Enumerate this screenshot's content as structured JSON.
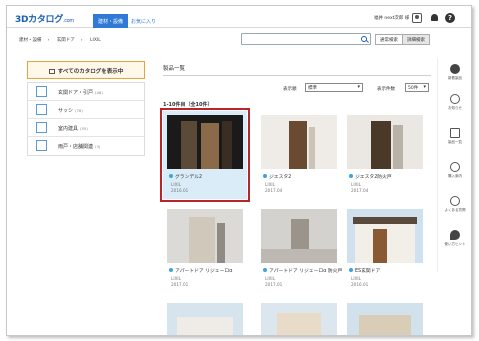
{
  "brand": {
    "name": "3Dカタログ",
    "suffix": ".com"
  },
  "nav": {
    "active_tab": "建材・設備",
    "favorites_tab": "お気に入り"
  },
  "user": {
    "label": "福井 next次郎 様"
  },
  "breadcrumb": [
    "建材・設備",
    "玄関ドア",
    "LIXIL"
  ],
  "search": {
    "value": "",
    "placeholder": ""
  },
  "modes": {
    "simple": "通常検索",
    "detail": "詳細検索"
  },
  "sidebar": {
    "show_all": "すべてのカタログを表示中",
    "items": [
      {
        "label": "玄関ドア・引戸",
        "count": "(48)",
        "icon": "door-icon"
      },
      {
        "label": "サッシ",
        "count": "(78)",
        "icon": "window-icon"
      },
      {
        "label": "室内建具",
        "count": "(55)",
        "icon": "interior-door-icon"
      },
      {
        "label": "雨戸・店舗関連",
        "count": "(3)",
        "icon": "storefront-icon"
      }
    ]
  },
  "main": {
    "section_title": "製品一覧",
    "sort_label": "表示順",
    "sort_value": "標準",
    "count_label": "表示件数",
    "count_value": "50件",
    "range_text": "1-10件目（全10件）"
  },
  "products": [
    {
      "title": "グランデル2",
      "maker": "LIXIL",
      "date": "2016.01",
      "selected": true
    },
    {
      "title": "ジエスタ2",
      "maker": "LIXIL",
      "date": "2017.04",
      "selected": false
    },
    {
      "title": "ジエスタ2防火戸",
      "maker": "LIXIL",
      "date": "2017.04",
      "selected": false
    },
    {
      "title": "アパートドア リジェーロα",
      "maker": "LIXIL",
      "date": "2017.01",
      "selected": false
    },
    {
      "title": "アパートドア リジェーロα 防火戸",
      "maker": "LIXIL",
      "date": "2017.01",
      "selected": false
    },
    {
      "title": "ES玄関ドア",
      "maker": "LIXIL",
      "date": "2016.01",
      "selected": false
    }
  ],
  "rail": [
    {
      "label": "新着製品",
      "icon": "new-icon"
    },
    {
      "label": "お知らせ",
      "icon": "info-icon"
    },
    {
      "label": "製品一覧",
      "icon": "catalog-icon"
    },
    {
      "label": "購入案内",
      "icon": "chat-icon"
    },
    {
      "label": "よくある質問",
      "icon": "faq-icon"
    },
    {
      "label": "使い方ヒント",
      "icon": "hint-icon"
    }
  ],
  "colors": {
    "brand_blue": "#2f7ad6",
    "highlight_red": "#b8262a",
    "accent_orange": "#e5a53a",
    "selected_bg": "#d9ecf8"
  }
}
